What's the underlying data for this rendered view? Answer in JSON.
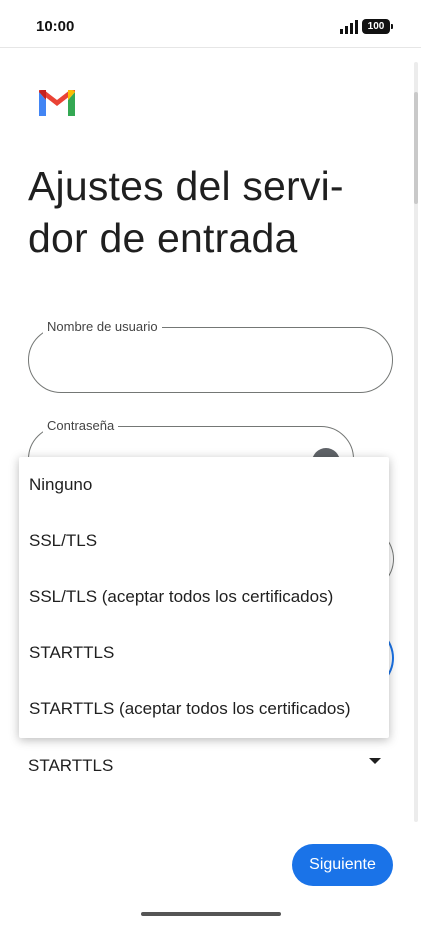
{
  "status_bar": {
    "time": "10:00",
    "battery": "100",
    "icons": [
      "signal-icon",
      "battery-icon"
    ]
  },
  "app": {
    "logo": "gmail-logo",
    "colors": {
      "accent": "#1a73e8",
      "outline": "#747775"
    }
  },
  "page": {
    "title": "Ajustes del servi-dor de entrada"
  },
  "fields": {
    "username_label": "Nombre de usuario",
    "username_value": "",
    "password_label": "Contraseña",
    "password_value": ""
  },
  "security": {
    "selected_value": "STARTTLS"
  },
  "dropdown": {
    "items": [
      {
        "label": "Ninguno"
      },
      {
        "label": "SSL/TLS"
      },
      {
        "label": "SSL/TLS (aceptar todos los certificados)"
      },
      {
        "label": "STARTTLS"
      },
      {
        "label": "STARTTLS (aceptar todos los certificados)"
      }
    ]
  },
  "actions": {
    "next_label": "Siguiente"
  }
}
